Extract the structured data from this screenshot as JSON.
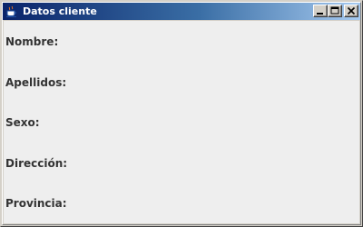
{
  "window": {
    "title": "Datos cliente",
    "icon": "java-cup-icon",
    "controls": {
      "minimize": "minimize-icon",
      "maximize": "maximize-icon",
      "close": "close-icon"
    }
  },
  "form": {
    "labels": [
      "Nombre:",
      "Apellidos:",
      "Sexo:",
      "Dirección:",
      "Provincia:"
    ]
  },
  "colors": {
    "titlebar_start": "#0a246a",
    "titlebar_end": "#a6caf0",
    "content_background": "#eeeeee",
    "label_text": "#333333"
  }
}
